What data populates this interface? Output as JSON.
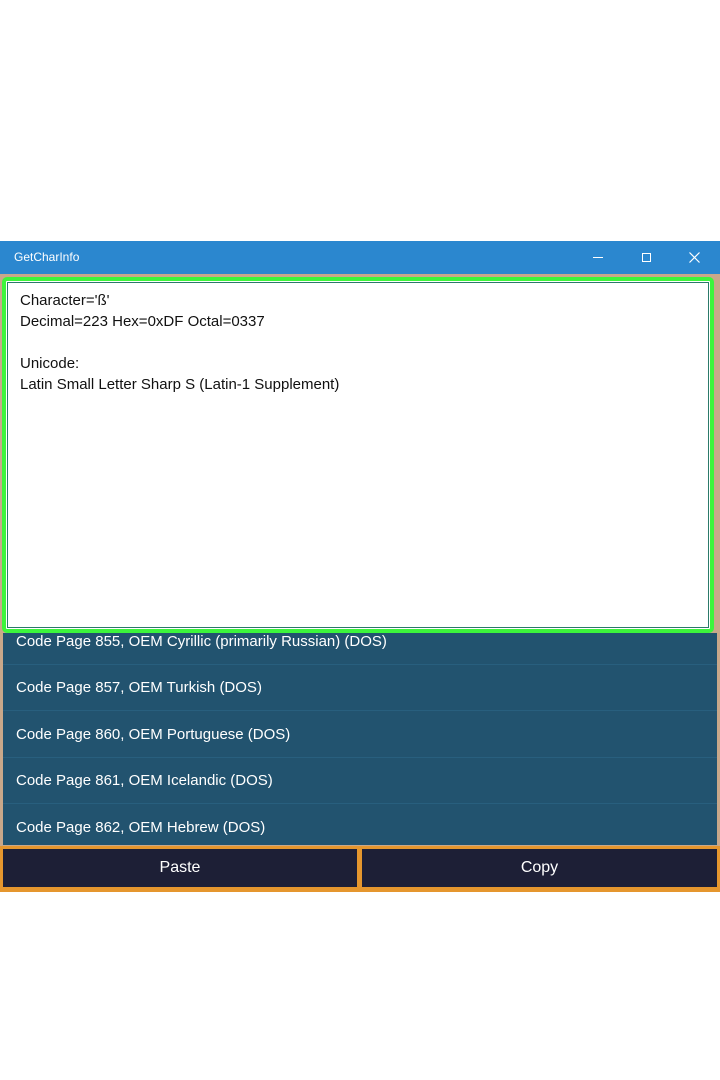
{
  "window": {
    "title": "GetCharInfo"
  },
  "info": {
    "lines": [
      "Character='ß'",
      "Decimal=223 Hex=0xDF Octal=0337",
      "",
      "Unicode:",
      "Latin Small Letter Sharp S (Latin-1 Supplement)"
    ]
  },
  "code_pages": {
    "items": [
      "Code Page 855, OEM Cyrillic (primarily Russian) (DOS)",
      "Code Page 857, OEM Turkish (DOS)",
      "Code Page 860, OEM Portuguese (DOS)",
      "Code Page 861, OEM Icelandic (DOS)",
      "Code Page 862, OEM Hebrew (DOS)"
    ]
  },
  "buttons": {
    "paste_label": "Paste",
    "copy_label": "Copy"
  },
  "icons": {
    "minimize": "minimize-icon",
    "maximize": "maximize-icon",
    "close": "close-icon"
  },
  "colors": {
    "titlebar": "#2b87cf",
    "focus_border": "#3cf53c",
    "list_background": "#22536f",
    "button_background": "#1d1f36",
    "button_border": "#e5962e"
  }
}
